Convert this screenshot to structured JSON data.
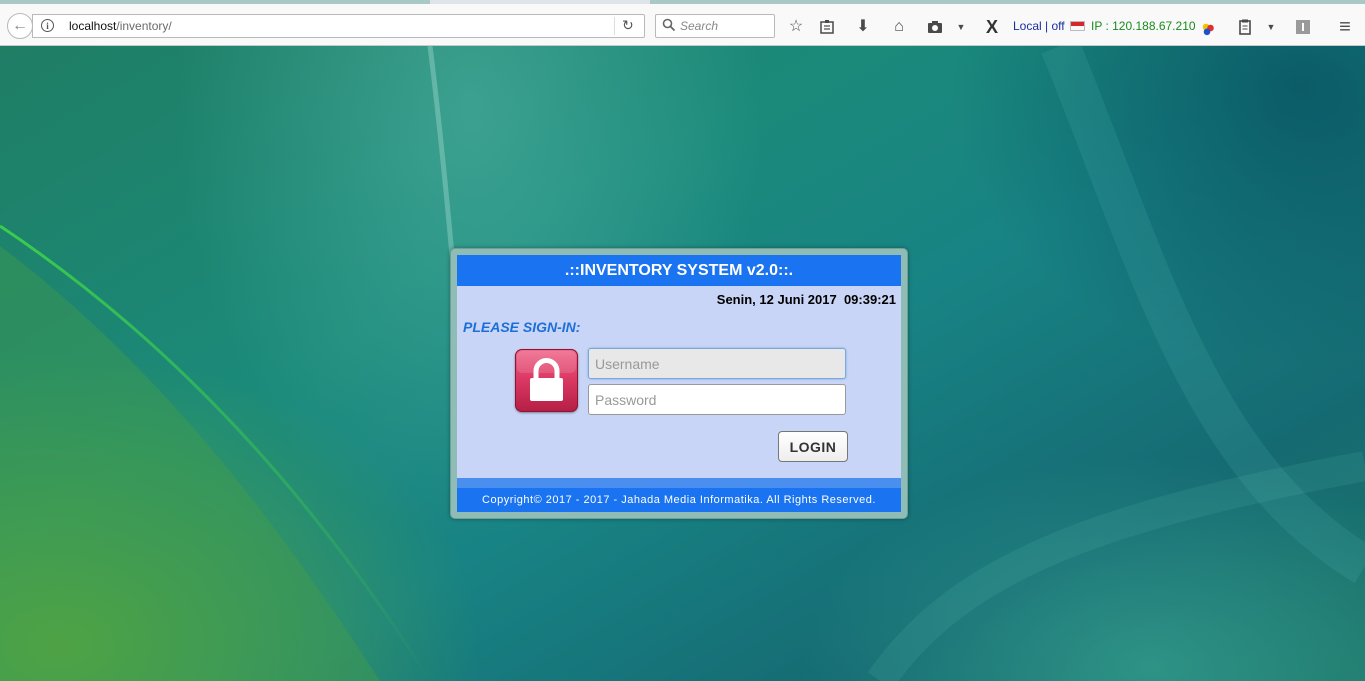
{
  "browser": {
    "url_host": "localhost",
    "url_path": "/inventory/",
    "search_placeholder": "Search",
    "addon_status": "Local | off",
    "ip_text": "IP : 120.188.67.210"
  },
  "login": {
    "title": ".::INVENTORY SYSTEM v2.0::.",
    "datetime": "Senin, 12 Juni 2017  09:39:21",
    "signin_label": "PLEASE SIGN-IN:",
    "username_placeholder": "Username",
    "password_placeholder": "Password",
    "login_button": "LOGIN",
    "footer": "Copyright© 2017 - 2017 - Jahada Media Informatika. All Rights Reserved."
  },
  "colors": {
    "title_bar": "#1a73f0",
    "panel_body": "#c9d5f6",
    "signin_label": "#1d6fd8",
    "lock_icon": "#dc3a64"
  },
  "icons": [
    "back-arrow-icon",
    "info-icon",
    "reload-icon",
    "search-icon",
    "bookmark-star-icon",
    "reading-list-icon",
    "download-icon",
    "home-icon",
    "camera-icon",
    "x-icon",
    "flag-icon",
    "colored-dots-icon",
    "clipboard-icon",
    "menu-icon",
    "lock-icon"
  ]
}
